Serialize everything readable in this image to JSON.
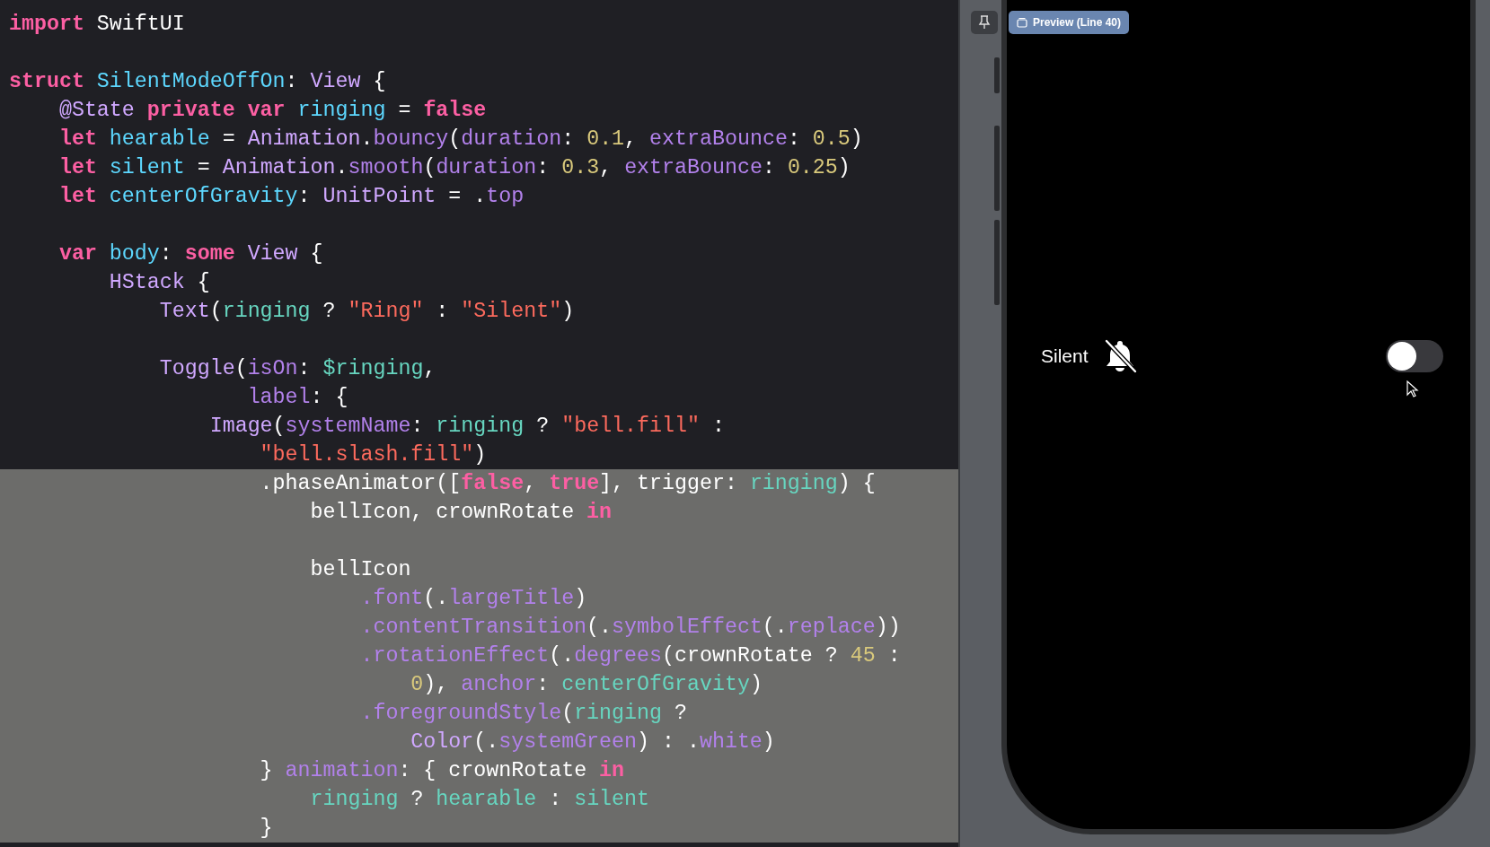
{
  "editor": {
    "lines": [
      {
        "selected": false,
        "tokens": [
          {
            "kind": "kw",
            "text": "import"
          },
          {
            "kind": "plain",
            "text": " SwiftUI"
          }
        ]
      },
      {
        "selected": false
      },
      {
        "selected": false,
        "tokens": [
          {
            "kind": "kw",
            "text": "struct"
          },
          {
            "kind": "decl",
            "text": " SilentModeOffOn"
          },
          {
            "kind": "plain",
            "text": ": "
          },
          {
            "kind": "type",
            "text": "View"
          },
          {
            "kind": "plain",
            "text": " {"
          }
        ]
      },
      {
        "selected": false,
        "tokens": [
          {
            "kind": "type",
            "text": "    @State"
          },
          {
            "kind": "kw",
            "text": " private var"
          },
          {
            "kind": "decl",
            "text": " ringing"
          },
          {
            "kind": "plain",
            "text": " = "
          },
          {
            "kind": "kw",
            "text": "false"
          }
        ]
      },
      {
        "selected": false,
        "tokens": [
          {
            "kind": "kw",
            "text": "    let"
          },
          {
            "kind": "decl",
            "text": " hearable"
          },
          {
            "kind": "plain",
            "text": " = "
          },
          {
            "kind": "type",
            "text": "Animation"
          },
          {
            "kind": "plain",
            "text": "."
          },
          {
            "kind": "func",
            "text": "bouncy"
          },
          {
            "kind": "plain",
            "text": "("
          },
          {
            "kind": "func",
            "text": "duration"
          },
          {
            "kind": "plain",
            "text": ": "
          },
          {
            "kind": "num",
            "text": "0.1"
          },
          {
            "kind": "plain",
            "text": ", "
          },
          {
            "kind": "func",
            "text": "extraBounce"
          },
          {
            "kind": "plain",
            "text": ": "
          },
          {
            "kind": "num",
            "text": "0.5"
          },
          {
            "kind": "plain",
            "text": ")"
          }
        ]
      },
      {
        "selected": false,
        "tokens": [
          {
            "kind": "kw",
            "text": "    let"
          },
          {
            "kind": "decl",
            "text": " silent"
          },
          {
            "kind": "plain",
            "text": " = "
          },
          {
            "kind": "type",
            "text": "Animation"
          },
          {
            "kind": "plain",
            "text": "."
          },
          {
            "kind": "func",
            "text": "smooth"
          },
          {
            "kind": "plain",
            "text": "("
          },
          {
            "kind": "func",
            "text": "duration"
          },
          {
            "kind": "plain",
            "text": ": "
          },
          {
            "kind": "num",
            "text": "0.3"
          },
          {
            "kind": "plain",
            "text": ", "
          },
          {
            "kind": "func",
            "text": "extraBounce"
          },
          {
            "kind": "plain",
            "text": ": "
          },
          {
            "kind": "num",
            "text": "0.25"
          },
          {
            "kind": "plain",
            "text": ")"
          }
        ]
      },
      {
        "selected": false,
        "tokens": [
          {
            "kind": "kw",
            "text": "    let"
          },
          {
            "kind": "decl",
            "text": " centerOfGravity"
          },
          {
            "kind": "plain",
            "text": ": "
          },
          {
            "kind": "type",
            "text": "UnitPoint"
          },
          {
            "kind": "plain",
            "text": " = ."
          },
          {
            "kind": "func",
            "text": "top"
          }
        ]
      },
      {
        "selected": false
      },
      {
        "selected": false,
        "tokens": [
          {
            "kind": "kw",
            "text": "    var"
          },
          {
            "kind": "decl",
            "text": " body"
          },
          {
            "kind": "plain",
            "text": ": "
          },
          {
            "kind": "kw",
            "text": "some"
          },
          {
            "kind": "type",
            "text": " View"
          },
          {
            "kind": "plain",
            "text": " {"
          }
        ]
      },
      {
        "selected": false,
        "tokens": [
          {
            "kind": "type",
            "text": "        HStack"
          },
          {
            "kind": "plain",
            "text": " {"
          }
        ]
      },
      {
        "selected": false,
        "tokens": [
          {
            "kind": "type",
            "text": "            Text"
          },
          {
            "kind": "plain",
            "text": "("
          },
          {
            "kind": "ident",
            "text": "ringing"
          },
          {
            "kind": "plain",
            "text": " ? "
          },
          {
            "kind": "str",
            "text": "\"Ring\""
          },
          {
            "kind": "plain",
            "text": " : "
          },
          {
            "kind": "str",
            "text": "\"Silent\""
          },
          {
            "kind": "plain",
            "text": ")"
          }
        ]
      },
      {
        "selected": false
      },
      {
        "selected": false,
        "tokens": [
          {
            "kind": "type",
            "text": "            Toggle"
          },
          {
            "kind": "plain",
            "text": "("
          },
          {
            "kind": "func",
            "text": "isOn"
          },
          {
            "kind": "plain",
            "text": ": "
          },
          {
            "kind": "ident",
            "text": "$ringing"
          },
          {
            "kind": "plain",
            "text": ","
          }
        ]
      },
      {
        "selected": false,
        "tokens": [
          {
            "kind": "func",
            "text": "                   label"
          },
          {
            "kind": "plain",
            "text": ": {"
          }
        ]
      },
      {
        "selected": false,
        "tokens": [
          {
            "kind": "type",
            "text": "                Image"
          },
          {
            "kind": "plain",
            "text": "("
          },
          {
            "kind": "func",
            "text": "systemName"
          },
          {
            "kind": "plain",
            "text": ": "
          },
          {
            "kind": "ident",
            "text": "ringing"
          },
          {
            "kind": "plain",
            "text": " ? "
          },
          {
            "kind": "str",
            "text": "\"bell.fill\""
          },
          {
            "kind": "plain",
            "text": " :"
          }
        ]
      },
      {
        "selected": false,
        "tokens": [
          {
            "kind": "str",
            "text": "                    \"bell.slash.fill\""
          },
          {
            "kind": "plain",
            "text": ")"
          }
        ]
      },
      {
        "selected": true,
        "tokens": [
          {
            "kind": "plain",
            "text": "                    ."
          },
          {
            "kind": "plain",
            "text": "phaseAnimator(["
          },
          {
            "kind": "kw",
            "text": "false"
          },
          {
            "kind": "plain",
            "text": ", "
          },
          {
            "kind": "kw",
            "text": "true"
          },
          {
            "kind": "plain",
            "text": "], trigger: "
          },
          {
            "kind": "ident",
            "text": "ringing"
          },
          {
            "kind": "plain",
            "text": ") {"
          }
        ]
      },
      {
        "selected": true,
        "tokens": [
          {
            "kind": "plain",
            "text": "                        bellIcon, crownRotate "
          },
          {
            "kind": "kw",
            "text": "in"
          }
        ]
      },
      {
        "selected": true
      },
      {
        "selected": true,
        "tokens": [
          {
            "kind": "plain",
            "text": "                        bellIcon"
          }
        ]
      },
      {
        "selected": true,
        "tokens": [
          {
            "kind": "func",
            "text": "                            .font"
          },
          {
            "kind": "plain",
            "text": "(."
          },
          {
            "kind": "func",
            "text": "largeTitle"
          },
          {
            "kind": "plain",
            "text": ")"
          }
        ]
      },
      {
        "selected": true,
        "tokens": [
          {
            "kind": "func",
            "text": "                            .contentTransition"
          },
          {
            "kind": "plain",
            "text": "(."
          },
          {
            "kind": "func",
            "text": "symbolEffect"
          },
          {
            "kind": "plain",
            "text": "(."
          },
          {
            "kind": "func",
            "text": "replace"
          },
          {
            "kind": "plain",
            "text": "))"
          }
        ]
      },
      {
        "selected": true,
        "tokens": [
          {
            "kind": "func",
            "text": "                            .rotationEffect"
          },
          {
            "kind": "plain",
            "text": "(."
          },
          {
            "kind": "func",
            "text": "degrees"
          },
          {
            "kind": "plain",
            "text": "(crownRotate ? "
          },
          {
            "kind": "num",
            "text": "45"
          },
          {
            "kind": "plain",
            "text": " :"
          }
        ]
      },
      {
        "selected": true,
        "tokens": [
          {
            "kind": "num",
            "text": "                                0"
          },
          {
            "kind": "plain",
            "text": "), "
          },
          {
            "kind": "func",
            "text": "anchor"
          },
          {
            "kind": "plain",
            "text": ": "
          },
          {
            "kind": "ident",
            "text": "centerOfGravity"
          },
          {
            "kind": "plain",
            "text": ")"
          }
        ]
      },
      {
        "selected": true,
        "tokens": [
          {
            "kind": "func",
            "text": "                            .foregroundStyle"
          },
          {
            "kind": "plain",
            "text": "("
          },
          {
            "kind": "ident",
            "text": "ringing"
          },
          {
            "kind": "plain",
            "text": " ?"
          }
        ]
      },
      {
        "selected": true,
        "tokens": [
          {
            "kind": "type",
            "text": "                                Color"
          },
          {
            "kind": "plain",
            "text": "(."
          },
          {
            "kind": "func",
            "text": "systemGreen"
          },
          {
            "kind": "plain",
            "text": ") : ."
          },
          {
            "kind": "func",
            "text": "white"
          },
          {
            "kind": "plain",
            "text": ")"
          }
        ]
      },
      {
        "selected": true,
        "tokens": [
          {
            "kind": "plain",
            "text": "                    } "
          },
          {
            "kind": "func",
            "text": "animation"
          },
          {
            "kind": "plain",
            "text": ": { crownRotate "
          },
          {
            "kind": "kw",
            "text": "in"
          }
        ]
      },
      {
        "selected": true,
        "tokens": [
          {
            "kind": "ident",
            "text": "                        ringing"
          },
          {
            "kind": "plain",
            "text": " ? "
          },
          {
            "kind": "ident",
            "text": "hearable"
          },
          {
            "kind": "plain",
            "text": " : "
          },
          {
            "kind": "ident",
            "text": "silent"
          }
        ]
      },
      {
        "selected": true,
        "tokens": [
          {
            "kind": "plain",
            "text": "                    }"
          }
        ]
      }
    ]
  },
  "preview": {
    "badge": "Preview (Line 40)",
    "label": "Silent",
    "toggle": {
      "on": false
    }
  }
}
